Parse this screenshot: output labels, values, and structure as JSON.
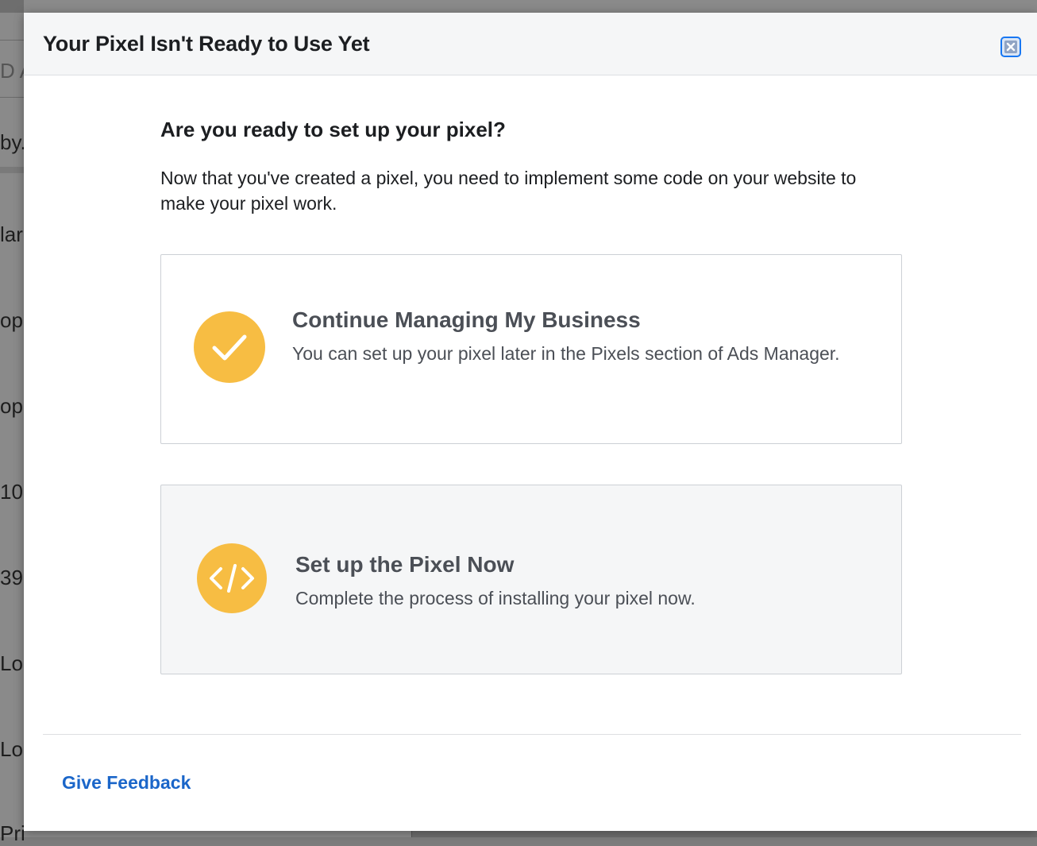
{
  "background": {
    "header_fragment": "D A",
    "row_fragments": [
      "by.",
      "lar",
      "opu",
      "opu",
      "10",
      "39",
      "Loc",
      "Loc",
      "Prince"
    ]
  },
  "dialog": {
    "title": "Your Pixel Isn't Ready to Use Yet",
    "close_icon": "close-icon",
    "question": "Are you ready to set up your pixel?",
    "description": "Now that you've created a pixel, you need to implement some code on your website to make your pixel work.",
    "options": [
      {
        "icon": "checkmark-icon",
        "title": "Continue Managing My Business",
        "description": "You can set up your pixel later in the Pixels section of Ads Manager."
      },
      {
        "icon": "code-icon",
        "title": "Set up the Pixel Now",
        "description": "Complete the process of installing your pixel now."
      }
    ],
    "feedback_label": "Give Feedback"
  },
  "colors": {
    "accent_icon": "#f7bd43",
    "link": "#1b66c9",
    "close_border": "#1877f2"
  }
}
